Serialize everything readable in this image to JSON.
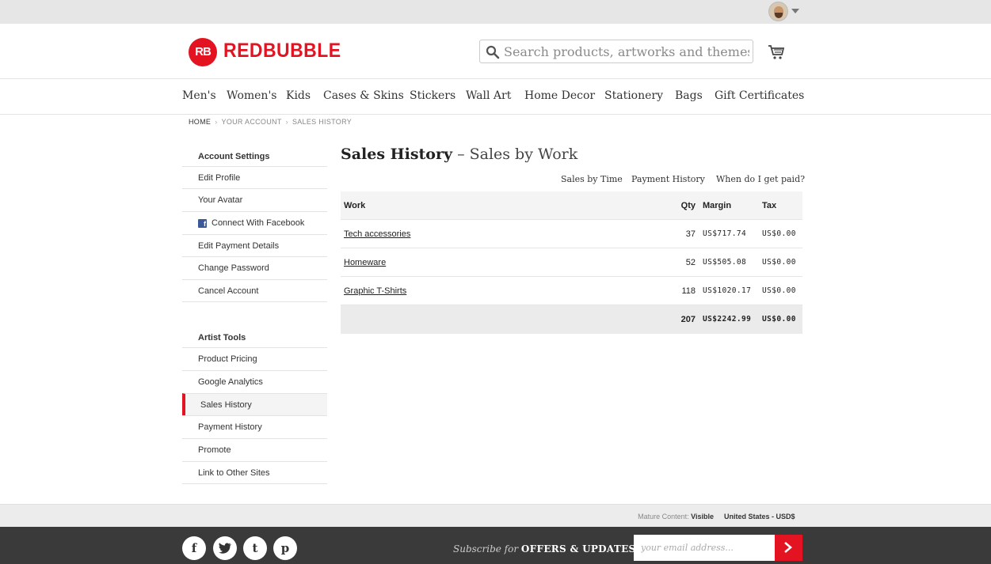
{
  "header": {
    "logo_mark": "RB",
    "logo_text": "REDBUBBLE",
    "search_placeholder": "Search products, artworks and themes"
  },
  "nav": [
    "Men's",
    "Women's",
    "Kids",
    "Cases & Skins",
    "Stickers",
    "Wall Art",
    "Home Decor",
    "Stationery",
    "Bags",
    "Gift Certificates"
  ],
  "breadcrumb": {
    "home": "HOME",
    "account": "YOUR ACCOUNT",
    "current": "SALES HISTORY",
    "sep": "›"
  },
  "sidebar": {
    "account_heading": "Account Settings",
    "account_items": [
      "Edit Profile",
      "Your Avatar",
      "Connect With Facebook",
      "Edit Payment Details",
      "Change Password",
      "Cancel Account"
    ],
    "artist_heading": "Artist Tools",
    "artist_items": [
      "Product Pricing",
      "Google Analytics",
      "Sales History",
      "Payment History",
      "Promote",
      "Link to Other Sites"
    ],
    "active_item": "Sales History"
  },
  "main": {
    "title": "Sales History",
    "subtitle": "– Sales by Work",
    "tabs": [
      "Sales by Time",
      "Payment History",
      "When do I get paid?"
    ]
  },
  "table": {
    "headers": {
      "work": "Work",
      "qty": "Qty",
      "margin": "Margin",
      "tax": "Tax"
    },
    "rows": [
      {
        "work": "Tech accessories",
        "qty": "37",
        "margin": "US$717.74",
        "tax": "US$0.00"
      },
      {
        "work": "Homeware",
        "qty": "52",
        "margin": "US$505.08",
        "tax": "US$0.00"
      },
      {
        "work": "Graphic T-Shirts",
        "qty": "118",
        "margin": "US$1020.17",
        "tax": "US$0.00"
      }
    ],
    "total": {
      "qty": "207",
      "margin": "US$2242.99",
      "tax": "US$0.00"
    }
  },
  "footer": {
    "mature_label": "Mature Content:",
    "mature_value": "Visible",
    "locale": "United States - USD$",
    "social": [
      "f",
      "t",
      "t",
      "p"
    ],
    "subscribe_prefix": "Subscribe for",
    "subscribe_strong": "OFFERS & UPDATES",
    "email_placeholder": "your email address..."
  },
  "colors": {
    "brand": "#e41321",
    "footer": "#3a3a3a"
  }
}
